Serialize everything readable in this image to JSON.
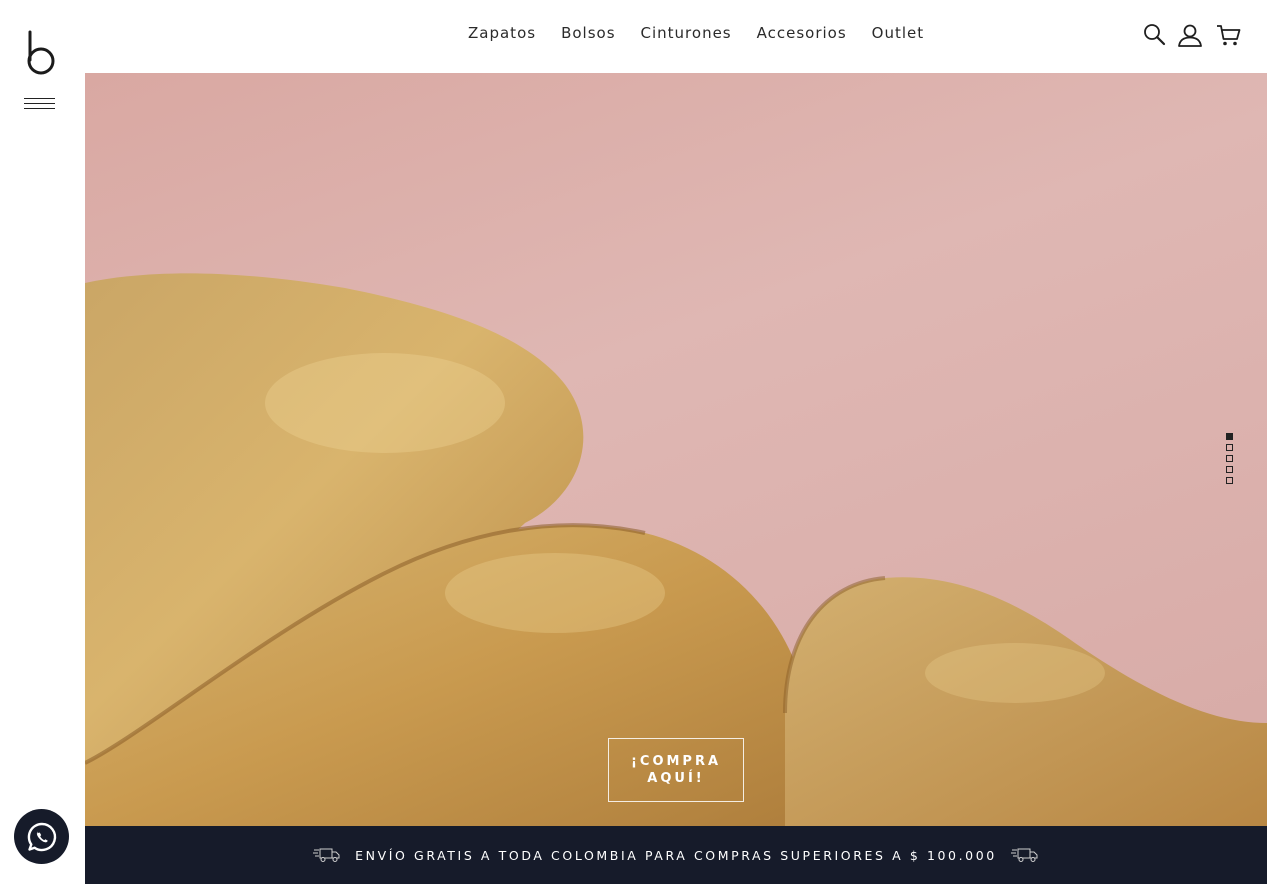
{
  "brand": {
    "logo_icon": "brand-b-logo"
  },
  "nav": {
    "items": [
      {
        "label": "Zapatos"
      },
      {
        "label": "Bolsos"
      },
      {
        "label": "Cinturones"
      },
      {
        "label": "Accesorios"
      },
      {
        "label": "Outlet"
      }
    ]
  },
  "header_icons": [
    "search-icon",
    "user-icon",
    "cart-icon"
  ],
  "hero": {
    "cta_label": "¡COMPRA AQUÍ!",
    "slides_total": 5,
    "active_slide": 1,
    "colors": {
      "background": "#dcb2ae",
      "gold": "#c9a35c"
    }
  },
  "shipping_bar": {
    "text": "ENVÍO GRATIS A TODA COLOMBIA PARA COMPRAS SUPERIORES A $ 100.000",
    "icon": "delivery-truck-icon",
    "background": "#161b2a"
  },
  "whatsapp": {
    "icon": "whatsapp-icon"
  }
}
